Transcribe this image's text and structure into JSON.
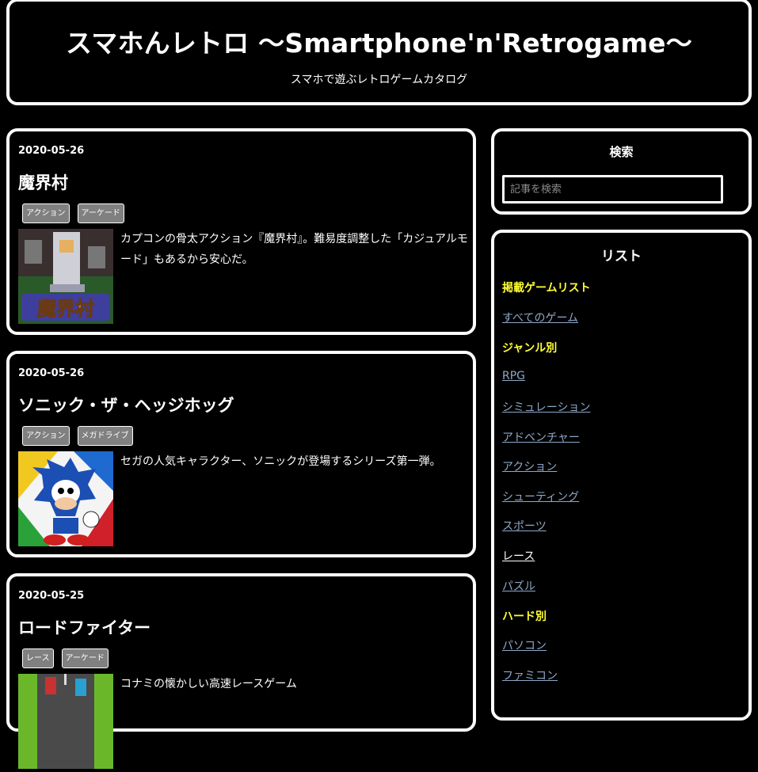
{
  "header": {
    "title": "スマホんレトロ 〜Smartphone'n'Retrogame〜",
    "subtitle": "スマホで遊ぶレトロゲームカタログ"
  },
  "posts": [
    {
      "date": "2020-05-26",
      "title": "魔界村",
      "tags": [
        "アクション",
        "アーケード"
      ],
      "thumb_text": "魔界村",
      "description": "カプコンの骨太アクション『魔界村』。難易度調整した「カジュアルモード」もあるから安心だ。"
    },
    {
      "date": "2020-05-26",
      "title": "ソニック・ザ・ヘッジホッグ",
      "tags": [
        "アクション",
        "メガドライブ"
      ],
      "description": "セガの人気キャラクター、ソニックが登場するシリーズ第一弾。"
    },
    {
      "date": "2020-05-25",
      "title": "ロードファイター",
      "tags": [
        "レース",
        "アーケード"
      ],
      "description": "コナミの懐かしい高速レースゲーム"
    }
  ],
  "sidebar": {
    "search": {
      "heading": "検索",
      "placeholder": "記事を検索"
    },
    "list": {
      "heading": "リスト",
      "items": [
        {
          "type": "category",
          "label": "掲載ゲームリスト"
        },
        {
          "type": "link",
          "label": "すべてのゲーム"
        },
        {
          "type": "category",
          "label": "ジャンル別"
        },
        {
          "type": "link",
          "label": "RPG"
        },
        {
          "type": "link",
          "label": "シミュレーション"
        },
        {
          "type": "link",
          "label": "アドベンチャー"
        },
        {
          "type": "link",
          "label": "アクション"
        },
        {
          "type": "link",
          "label": "シューティング"
        },
        {
          "type": "link",
          "label": "スポーツ"
        },
        {
          "type": "link",
          "label": "レース",
          "active": true
        },
        {
          "type": "link",
          "label": "パズル"
        },
        {
          "type": "category",
          "label": "ハード別"
        },
        {
          "type": "link",
          "label": "パソコン"
        },
        {
          "type": "link",
          "label": "ファミコン"
        }
      ]
    }
  },
  "colors": {
    "background": "#000000",
    "border": "#ffffff",
    "category": "#ffff33",
    "link": "#8fa8c8",
    "tag_bg": "#808080"
  }
}
